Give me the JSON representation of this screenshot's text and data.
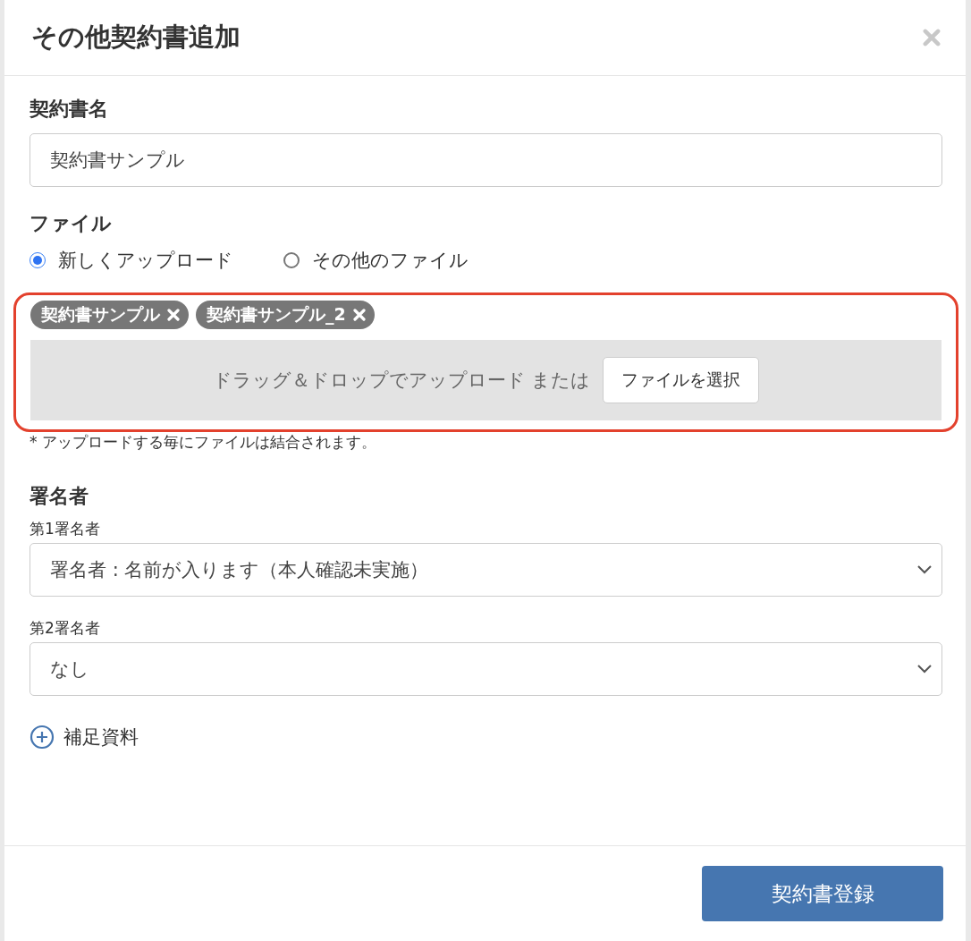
{
  "dialog": {
    "title": "その他契約書追加"
  },
  "name_field": {
    "label": "契約書名",
    "value": "契約書サンプル"
  },
  "file": {
    "label": "ファイル",
    "options": [
      {
        "label": "新しくアップロード",
        "selected": true
      },
      {
        "label": "その他のファイル",
        "selected": false
      }
    ],
    "upload": {
      "highlighted": true,
      "attached_files": [
        "契約書サンプル",
        "契約書サンプル_2"
      ],
      "drop_text": "ドラッグ＆ドロップでアップロード または",
      "choose_button": "ファイルを選択"
    },
    "note": "* アップロードする毎にファイルは結合されます。"
  },
  "signers": {
    "label": "署名者",
    "fields": [
      {
        "label": "第1署名者",
        "value": "署名者 : 名前が入ります（本人確認未実施）"
      },
      {
        "label": "第2署名者",
        "value": "なし"
      }
    ]
  },
  "supplementary": {
    "label": "補足資料"
  },
  "submit_button": "契約書登録"
}
